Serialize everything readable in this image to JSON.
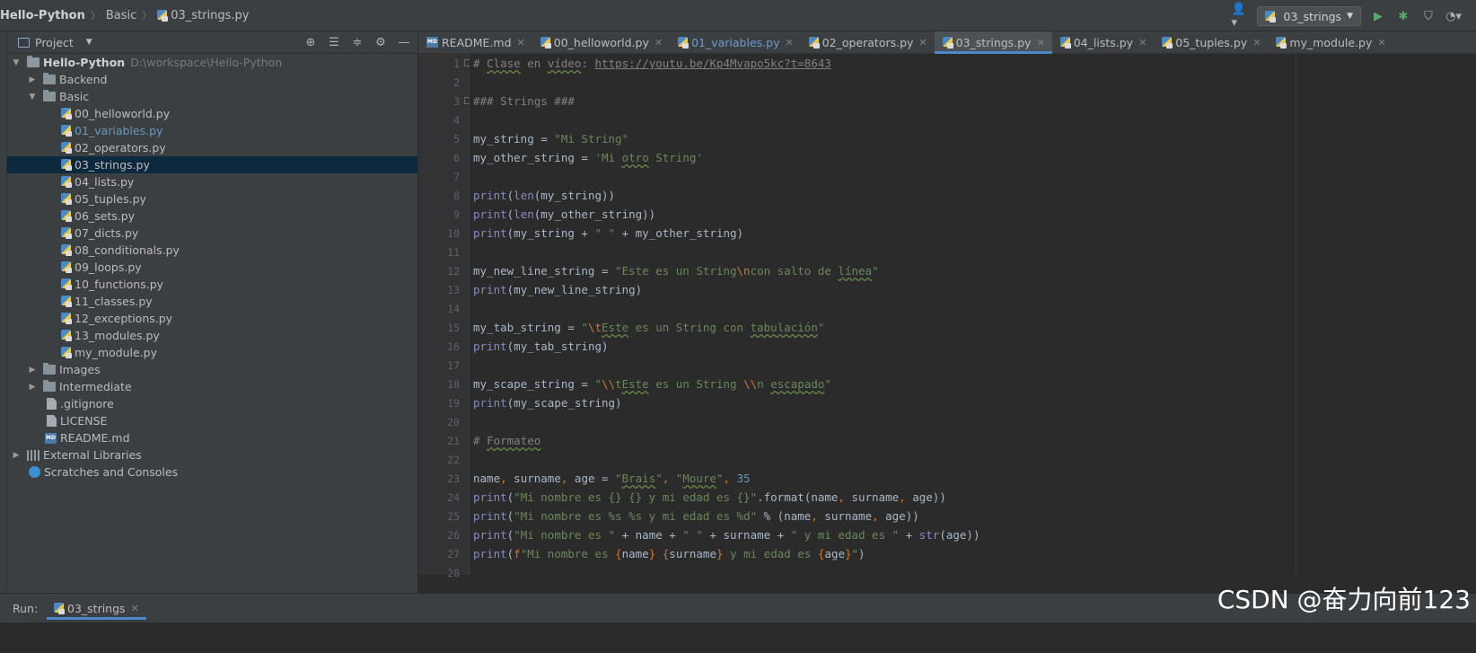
{
  "breadcrumb": {
    "project": "Hello-Python",
    "folder": "Basic",
    "file": "03_strings.py"
  },
  "toolbar": {
    "run_config": "03_strings"
  },
  "project_panel": {
    "title": "Project",
    "root": {
      "name": "Hello-Python",
      "path": "D:\\workspace\\Hello-Python"
    },
    "folders": {
      "backend": "Backend",
      "basic": "Basic",
      "images": "Images",
      "intermediate": "Intermediate"
    },
    "files": [
      "00_helloworld.py",
      "01_variables.py",
      "02_operators.py",
      "03_strings.py",
      "04_lists.py",
      "05_tuples.py",
      "06_sets.py",
      "07_dicts.py",
      "08_conditionals.py",
      "09_loops.py",
      "10_functions.py",
      "11_classes.py",
      "12_exceptions.py",
      "13_modules.py",
      "my_module.py"
    ],
    "root_files": {
      "gitignore": ".gitignore",
      "license": "LICENSE",
      "readme": "README.md"
    },
    "external_libraries": "External Libraries",
    "scratches": "Scratches and Consoles"
  },
  "tabs": [
    "README.md",
    "00_helloworld.py",
    "01_variables.py",
    "02_operators.py",
    "03_strings.py",
    "04_lists.py",
    "05_tuples.py",
    "my_module.py"
  ],
  "editor": {
    "line_numbers": [
      "1",
      "2",
      "3",
      "4",
      "5",
      "6",
      "7",
      "8",
      "9",
      "10",
      "11",
      "12",
      "13",
      "14",
      "15",
      "16",
      "17",
      "18",
      "19",
      "20",
      "21",
      "22",
      "23",
      "24",
      "25",
      "26",
      "27",
      "28"
    ]
  },
  "run_panel": {
    "label": "Run:",
    "tab": "03_strings"
  },
  "watermark": "CSDN @奋力向前123",
  "colors": {
    "accent": "#4a88c7",
    "selection": "#0d293e",
    "editor_bg": "#2b2b2b",
    "panel_bg": "#3c3f41"
  }
}
